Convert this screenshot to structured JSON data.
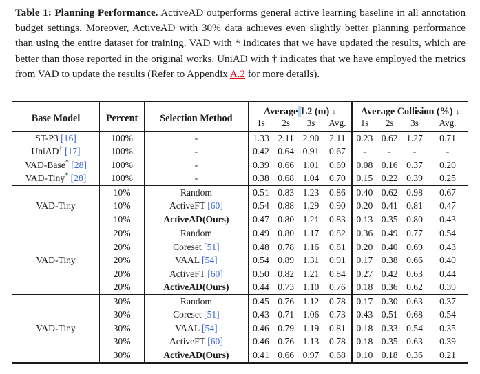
{
  "caption": {
    "label": "Table 1: Planning Performance.",
    "body_parts": [
      " ActiveAD outperforms general active learning baseline in all annotation budget settings. Moreover, ActiveAD with 30% data achieves even slightly better planning performance than using the entire dataset for training. VAD with * indicates that we have updated the results, which are better than those reported in the original works. UniAD with † indicates that we have employed the metrics from VAD to update the results (Refer to Appendix ",
      " for more details)."
    ],
    "link": "A.2",
    "link_color": "#e2001a"
  },
  "table": {
    "columns": {
      "base_model": "Base Model",
      "percent": "Percent",
      "selection_method": "Selection Method",
      "group_l2": "Average L2 (m)",
      "group_l2_pre": "Average",
      "group_l2_post": "L2 (m)",
      "group_collision": "Average Collision (%)",
      "arrow": "↓",
      "sub": [
        "1s",
        "2s",
        "3s",
        "Avg."
      ]
    },
    "citation_color": "#3a66d8",
    "blocks": [
      {
        "model": "",
        "rows": [
          {
            "model": "ST-P3",
            "model_sup": "",
            "model_cite": "[16]",
            "percent": "100%",
            "method": "-",
            "method_cite": "",
            "bold": false,
            "l2": [
              "1.33",
              "2.11",
              "2.90",
              "2.11"
            ],
            "col": [
              "0.23",
              "0.62",
              "1.27",
              "0.71"
            ]
          },
          {
            "model": "UniAD",
            "model_sup": "†",
            "model_cite": "[17]",
            "percent": "100%",
            "method": "-",
            "method_cite": "",
            "bold": false,
            "l2": [
              "0.42",
              "0.64",
              "0.91",
              "0.67"
            ],
            "col": [
              "-",
              "-",
              "-",
              "-"
            ]
          },
          {
            "model": "VAD-Base",
            "model_sup": "*",
            "model_cite": "[28]",
            "percent": "100%",
            "method": "-",
            "method_cite": "",
            "bold": false,
            "l2": [
              "0.39",
              "0.66",
              "1.01",
              "0.69"
            ],
            "col": [
              "0.08",
              "0.16",
              "0.37",
              "0.20"
            ]
          },
          {
            "model": "VAD-Tiny",
            "model_sup": "*",
            "model_cite": "[28]",
            "percent": "100%",
            "method": "-",
            "method_cite": "",
            "bold": false,
            "l2": [
              "0.38",
              "0.68",
              "1.04",
              "0.70"
            ],
            "col": [
              "0.15",
              "0.22",
              "0.39",
              "0.25"
            ]
          }
        ]
      },
      {
        "model": "VAD-Tiny",
        "rows": [
          {
            "model": "",
            "model_sup": "",
            "model_cite": "",
            "percent": "10%",
            "method": "Random",
            "method_cite": "",
            "bold": false,
            "l2": [
              "0.51",
              "0.83",
              "1.23",
              "0.86"
            ],
            "col": [
              "0.40",
              "0.62",
              "0.98",
              "0.67"
            ]
          },
          {
            "model": "",
            "model_sup": "",
            "model_cite": "",
            "percent": "10%",
            "method": "ActiveFT",
            "method_cite": "[60]",
            "bold": false,
            "l2": [
              "0.54",
              "0.88",
              "1.29",
              "0.90"
            ],
            "col": [
              "0.20",
              "0.41",
              "0.81",
              "0.47"
            ]
          },
          {
            "model": "",
            "model_sup": "",
            "model_cite": "",
            "percent": "10%",
            "method": "ActiveAD(Ours)",
            "method_cite": "",
            "bold": true,
            "l2": [
              "0.47",
              "0.80",
              "1.21",
              "0.83"
            ],
            "col": [
              "0.13",
              "0.35",
              "0.80",
              "0.43"
            ]
          }
        ]
      },
      {
        "model": "VAD-Tiny",
        "rows": [
          {
            "model": "",
            "model_sup": "",
            "model_cite": "",
            "percent": "20%",
            "method": "Random",
            "method_cite": "",
            "bold": false,
            "l2": [
              "0.49",
              "0.80",
              "1.17",
              "0.82"
            ],
            "col": [
              "0.36",
              "0.49",
              "0.77",
              "0.54"
            ]
          },
          {
            "model": "",
            "model_sup": "",
            "model_cite": "",
            "percent": "20%",
            "method": "Coreset",
            "method_cite": "[51]",
            "bold": false,
            "l2": [
              "0.48",
              "0.78",
              "1.16",
              "0.81"
            ],
            "col": [
              "0.20",
              "0.40",
              "0.69",
              "0.43"
            ]
          },
          {
            "model": "",
            "model_sup": "",
            "model_cite": "",
            "percent": "20%",
            "method": "VAAL",
            "method_cite": "[54]",
            "bold": false,
            "l2": [
              "0.54",
              "0.89",
              "1.31",
              "0.91"
            ],
            "col": [
              "0.17",
              "0.38",
              "0.66",
              "0.40"
            ]
          },
          {
            "model": "",
            "model_sup": "",
            "model_cite": "",
            "percent": "20%",
            "method": "ActiveFT",
            "method_cite": "[60]",
            "bold": false,
            "l2": [
              "0.50",
              "0.82",
              "1.21",
              "0.84"
            ],
            "col": [
              "0.27",
              "0.42",
              "0.63",
              "0.44"
            ]
          },
          {
            "model": "",
            "model_sup": "",
            "model_cite": "",
            "percent": "20%",
            "method": "ActiveAD(Ours)",
            "method_cite": "",
            "bold": true,
            "l2": [
              "0.44",
              "0.73",
              "1.10",
              "0.76"
            ],
            "col": [
              "0.18",
              "0.36",
              "0.62",
              "0.39"
            ]
          }
        ]
      },
      {
        "model": "VAD-Tiny",
        "rows": [
          {
            "model": "",
            "model_sup": "",
            "model_cite": "",
            "percent": "30%",
            "method": "Random",
            "method_cite": "",
            "bold": false,
            "l2": [
              "0.45",
              "0.76",
              "1.12",
              "0.78"
            ],
            "col": [
              "0.17",
              "0.30",
              "0.63",
              "0.37"
            ]
          },
          {
            "model": "",
            "model_sup": "",
            "model_cite": "",
            "percent": "30%",
            "method": "Coreset",
            "method_cite": "[51]",
            "bold": false,
            "l2": [
              "0.43",
              "0.71",
              "1.06",
              "0.73"
            ],
            "col": [
              "0.43",
              "0.51",
              "0.68",
              "0.54"
            ]
          },
          {
            "model": "",
            "model_sup": "",
            "model_cite": "",
            "percent": "30%",
            "method": "VAAL",
            "method_cite": "[54]",
            "bold": false,
            "l2": [
              "0.46",
              "0.79",
              "1.19",
              "0.81"
            ],
            "col": [
              "0.18",
              "0.33",
              "0.54",
              "0.35"
            ]
          },
          {
            "model": "",
            "model_sup": "",
            "model_cite": "",
            "percent": "30%",
            "method": "ActiveFT",
            "method_cite": "[60]",
            "bold": false,
            "l2": [
              "0.46",
              "0.76",
              "1.13",
              "0.78"
            ],
            "col": [
              "0.18",
              "0.35",
              "0.63",
              "0.39"
            ]
          },
          {
            "model": "",
            "model_sup": "",
            "model_cite": "",
            "percent": "30%",
            "method": "ActiveAD(Ours)",
            "method_cite": "",
            "bold": true,
            "l2": [
              "0.41",
              "0.66",
              "0.97",
              "0.68"
            ],
            "col": [
              "0.10",
              "0.18",
              "0.36",
              "0.21"
            ]
          }
        ]
      }
    ]
  },
  "selection": {
    "highlighted_text": " ",
    "color": "#b4d5f5"
  }
}
